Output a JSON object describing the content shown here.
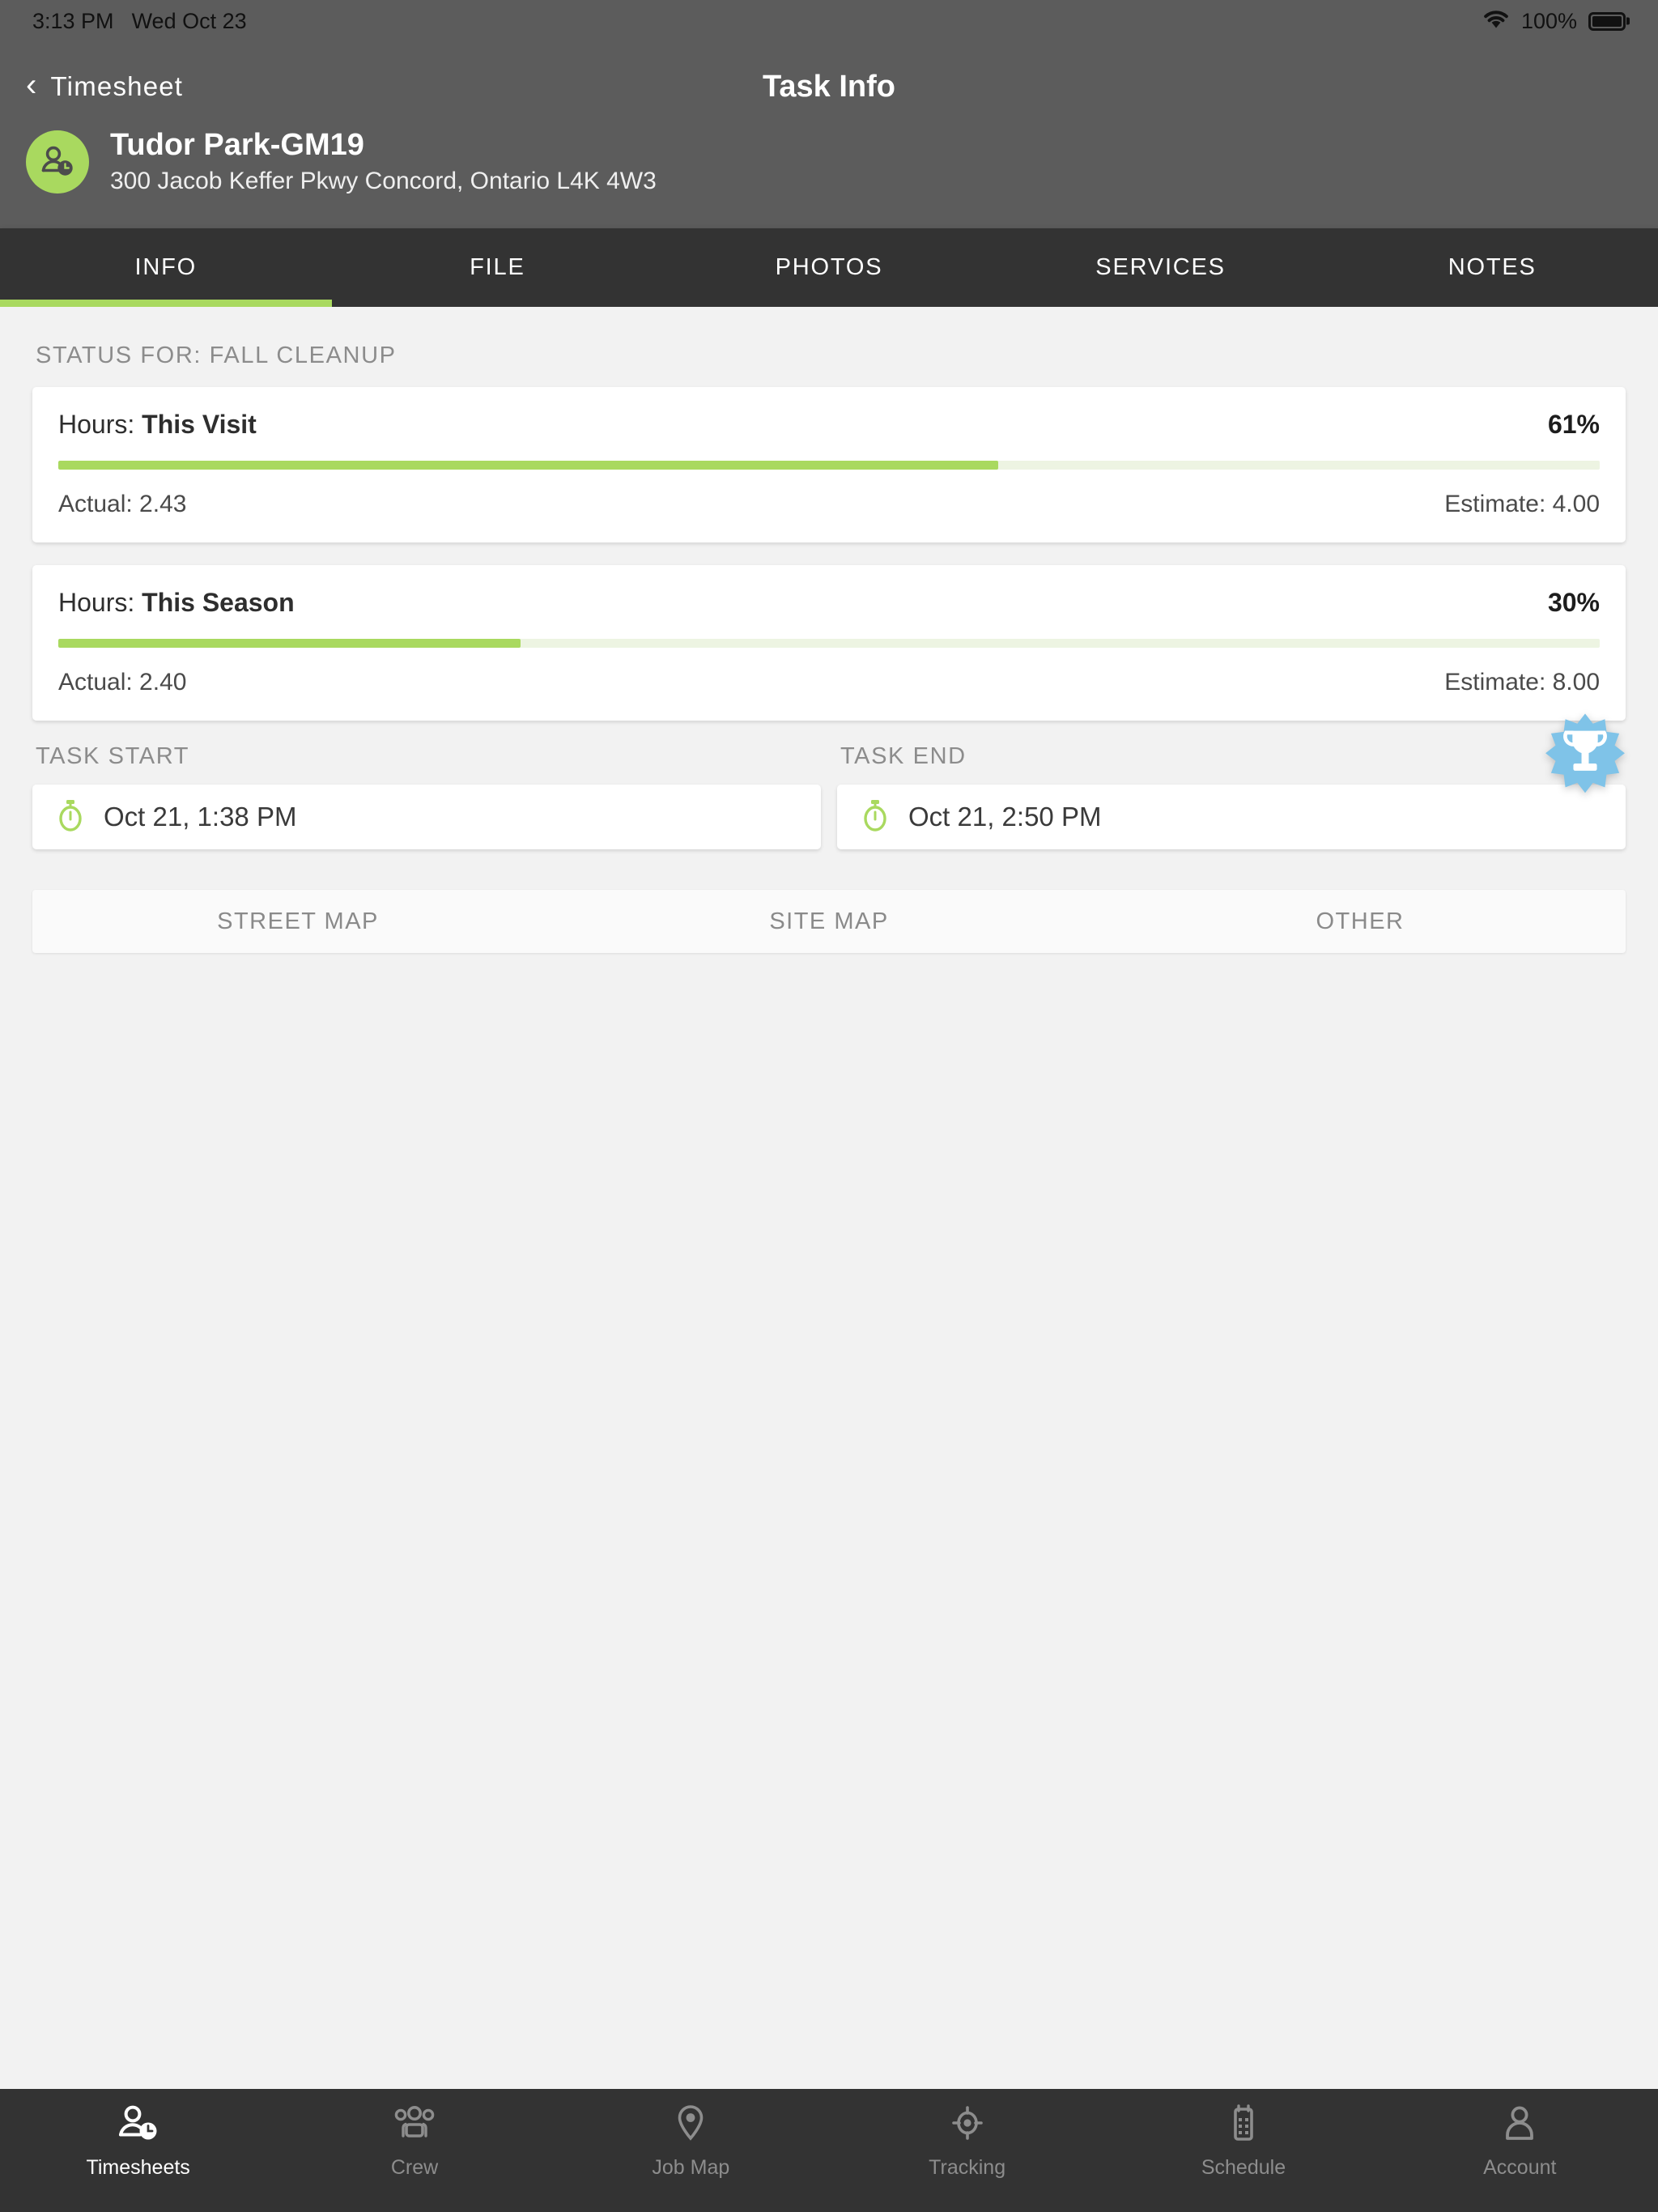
{
  "statusbar": {
    "time": "3:13 PM",
    "date": "Wed Oct 23",
    "battery_pct": "100%",
    "wifi_icon": "wifi-icon",
    "battery_icon": "battery-full-icon"
  },
  "navbar": {
    "back_label": "Timesheet",
    "back_icon": "chevron-left-icon",
    "title": "Task Info",
    "site_name": "Tudor Park-GM19",
    "site_address": "300 Jacob Keffer Pkwy Concord, Ontario L4K 4W3",
    "avatar_icon": "person-clock-icon"
  },
  "tabs": [
    {
      "label": "INFO",
      "active": true
    },
    {
      "label": "FILE",
      "active": false
    },
    {
      "label": "PHOTOS",
      "active": false
    },
    {
      "label": "SERVICES",
      "active": false
    },
    {
      "label": "NOTES",
      "active": false
    }
  ],
  "status_section": {
    "label": "STATUS FOR: FALL CLEANUP",
    "cards": [
      {
        "hours_prefix": "Hours:",
        "hours_scope": "This Visit",
        "percent_label": "61%",
        "percent_value": 61,
        "actual_label": "Actual: 2.43",
        "estimate_label": "Estimate: 4.00"
      },
      {
        "hours_prefix": "Hours:",
        "hours_scope": "This Season",
        "percent_label": "30%",
        "percent_value": 30,
        "actual_label": "Actual: 2.40",
        "estimate_label": "Estimate: 8.00"
      }
    ]
  },
  "task_times": {
    "start_label": "TASK START",
    "start_value": "Oct 21, 1:38 PM",
    "start_icon": "stopwatch-icon",
    "end_label": "TASK END",
    "end_value": "Oct 21, 2:50 PM",
    "end_icon": "stopwatch-icon",
    "badge_icon": "trophy-badge-icon"
  },
  "map_tabs": [
    {
      "label": "STREET MAP"
    },
    {
      "label": "SITE MAP"
    },
    {
      "label": "OTHER"
    }
  ],
  "bottom_nav": [
    {
      "label": "Timesheets",
      "icon": "person-clock-icon",
      "active": true
    },
    {
      "label": "Crew",
      "icon": "people-group-icon",
      "active": false
    },
    {
      "label": "Job Map",
      "icon": "map-pin-icon",
      "active": false
    },
    {
      "label": "Tracking",
      "icon": "crosshair-icon",
      "active": false
    },
    {
      "label": "Schedule",
      "icon": "calendar-icon",
      "active": false
    },
    {
      "label": "Account",
      "icon": "person-icon",
      "active": false
    }
  ],
  "colors": {
    "accent_green": "#a9d95f",
    "header_gray": "#5c5c5c",
    "tabbar_dark": "#333333",
    "page_bg": "#f2f2f2",
    "badge_blue": "#7fc3e8"
  }
}
